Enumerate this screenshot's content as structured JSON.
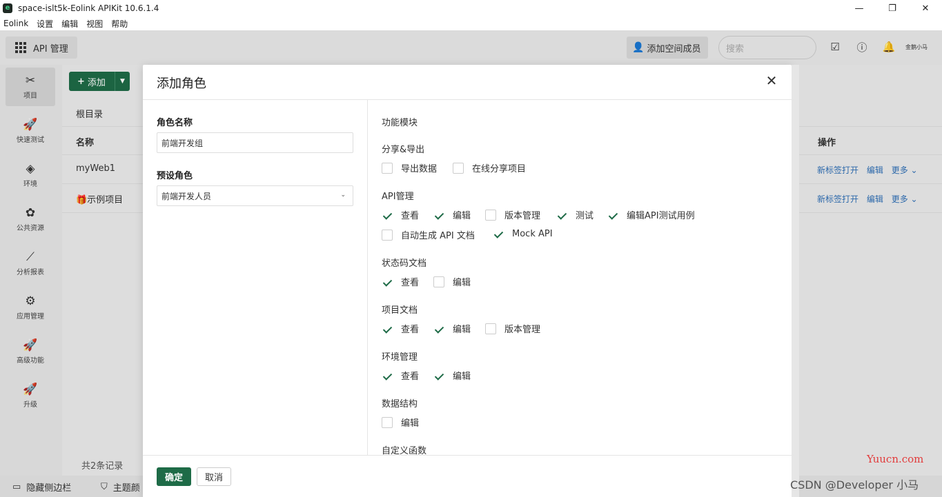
{
  "window": {
    "title": "space-islt5k-Eolink APIKit 10.6.1.4",
    "controls": [
      "—",
      "❐",
      "✕"
    ]
  },
  "menu": [
    "Eolink",
    "设置",
    "编辑",
    "视图",
    "帮助"
  ],
  "header": {
    "app_label": "API 管理",
    "add_member": "添加空间成员",
    "search_placeholder": "搜索",
    "avatar_text": "金鹅小马"
  },
  "sidebar": [
    {
      "label": "项目",
      "icon": "project-icon",
      "glyph": "✂",
      "active": true
    },
    {
      "label": "快速测试",
      "icon": "rocket-icon",
      "glyph": "🚀"
    },
    {
      "label": "环境",
      "icon": "cube-icon",
      "glyph": "◈"
    },
    {
      "label": "公共资源",
      "icon": "puzzle-icon",
      "glyph": "✿"
    },
    {
      "label": "分析报表",
      "icon": "chart-icon",
      "glyph": "⟋"
    },
    {
      "label": "应用管理",
      "icon": "gear-icon",
      "glyph": "⚙"
    },
    {
      "label": "高级功能",
      "icon": "rocket-icon",
      "glyph": "🚀"
    },
    {
      "label": "升级",
      "icon": "rocket-icon",
      "glyph": "🚀"
    }
  ],
  "main": {
    "add_button": "添加",
    "breadcrumb": "根目录",
    "columns": {
      "name": "名称",
      "ops": "操作"
    },
    "rows": [
      {
        "name": "myWeb1",
        "ops": [
          "新标签打开",
          "编辑",
          "更多 ⌄"
        ]
      },
      {
        "name": "🎁示例项目",
        "ops": [
          "新标签打开",
          "编辑",
          "更多 ⌄"
        ]
      }
    ],
    "records": "共2条记录"
  },
  "bottom": {
    "hide_sidebar": "隐藏侧边栏",
    "theme": "主题颜"
  },
  "modal": {
    "title": "添加角色",
    "close": "✕",
    "role_name_label": "角色名称",
    "role_name_value": "前端开发组",
    "preset_label": "预设角色",
    "preset_value": "前端开发人员",
    "module_title": "功能模块",
    "sections": [
      {
        "title": "分享&导出",
        "items": [
          {
            "label": "导出数据",
            "checked": false
          },
          {
            "label": "在线分享项目",
            "checked": false
          }
        ]
      },
      {
        "title": "API管理",
        "items": [
          {
            "label": "查看",
            "checked": true
          },
          {
            "label": "编辑",
            "checked": true
          },
          {
            "label": "版本管理",
            "checked": false
          },
          {
            "label": "测试",
            "checked": true
          },
          {
            "label": "编辑API测试用例",
            "checked": true
          },
          {
            "label": "自动生成 API 文档",
            "checked": false
          },
          {
            "label": "Mock API",
            "checked": true
          }
        ]
      },
      {
        "title": "状态码文档",
        "items": [
          {
            "label": "查看",
            "checked": true
          },
          {
            "label": "编辑",
            "checked": false
          }
        ]
      },
      {
        "title": "项目文档",
        "items": [
          {
            "label": "查看",
            "checked": true
          },
          {
            "label": "编辑",
            "checked": true
          },
          {
            "label": "版本管理",
            "checked": false
          }
        ]
      },
      {
        "title": "环境管理",
        "items": [
          {
            "label": "查看",
            "checked": true
          },
          {
            "label": "编辑",
            "checked": true
          }
        ]
      },
      {
        "title": "数据结构",
        "items": [
          {
            "label": "编辑",
            "checked": false
          }
        ]
      },
      {
        "title": "自定义函数",
        "items": []
      }
    ],
    "ok": "确定",
    "cancel": "取消"
  },
  "watermarks": {
    "yuucn": "Yuucn.com",
    "csdn": "CSDN @Developer 小马"
  }
}
